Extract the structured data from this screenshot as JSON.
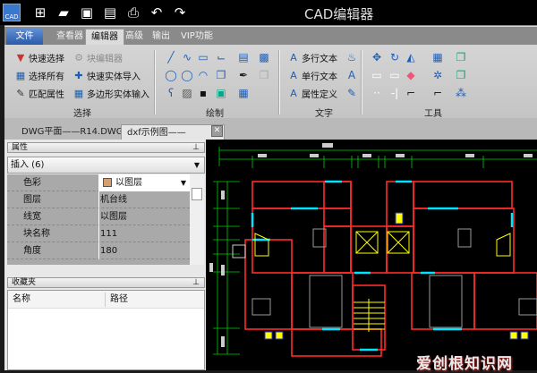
{
  "titlebar": {
    "title": "CAD编辑器",
    "logo_text": "CAD",
    "quick_icons": [
      "new-icon",
      "open-icon",
      "save-icon",
      "save-as-icon",
      "print-icon",
      "undo-icon",
      "redo-icon"
    ]
  },
  "ribbon": {
    "tabs": [
      "文件",
      "查看器",
      "编辑器",
      "高级",
      "输出",
      "VIP功能"
    ],
    "active_tab": "编辑器",
    "select_group": {
      "label": "选择",
      "items": [
        "快速选择",
        "选择所有",
        "匹配属性",
        "块编辑器",
        "快速实体导入",
        "多边形实体输入"
      ]
    },
    "draw_group": {
      "label": "绘制"
    },
    "text_group": {
      "label": "文字",
      "items": [
        "多行文本",
        "单行文本",
        "属性定义"
      ]
    },
    "tools_group": {
      "label": "工具"
    }
  },
  "doc_tabs": [
    {
      "label": "DWG平面——R14.DWG",
      "active": false
    },
    {
      "label": "dxf示例图——2004.dxf",
      "active": true
    }
  ],
  "properties": {
    "title": "属性",
    "selection": "插入 (6)",
    "rows": [
      {
        "label": "色彩",
        "value": "以图层",
        "swatch": "#d4a070"
      },
      {
        "label": "图层",
        "value": "机台线"
      },
      {
        "label": "线宽",
        "value": "以图层"
      },
      {
        "label": "块名称",
        "value": "111"
      },
      {
        "label": "角度",
        "value": "180"
      }
    ]
  },
  "favorites": {
    "title": "收藏夹",
    "columns": [
      "名称",
      "路径"
    ]
  },
  "watermark": "爱创根知识网",
  "colors": {
    "canvas": "#000000",
    "wall": "#ff2a2a",
    "dim": "#00ff00",
    "window": "#00e5ff",
    "stair": "#ffff00",
    "accent": "#2b5aa8"
  }
}
